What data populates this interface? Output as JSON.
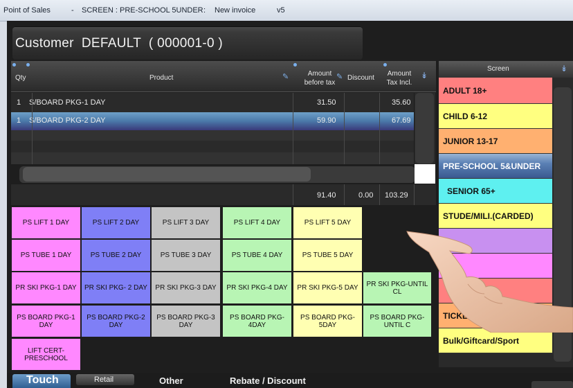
{
  "window": {
    "title_parts": [
      "Point of Sales",
      "-",
      "SCREEN : PRE-SCHOOL 5UNDER",
      ":",
      "New invoice",
      "v5"
    ]
  },
  "customer": {
    "label": "Customer  DEFAULT  ( 000001-0 )"
  },
  "grid": {
    "headers": {
      "qty": "Qty",
      "product": "Product",
      "amount_before_tax": [
        "Amount",
        "before tax"
      ],
      "discount": "Discount",
      "amount_tax_incl": [
        "Amount",
        "Tax Incl."
      ]
    },
    "rows": [
      {
        "qty": "1",
        "product": "S/BOARD PKG-1 DAY",
        "amount_before_tax": "31.50",
        "discount": "",
        "amount_tax_incl": "35.60",
        "selected": false
      },
      {
        "qty": "1",
        "product": "S/BOARD PKG-2 DAY",
        "amount_before_tax": "59.90",
        "discount": "",
        "amount_tax_incl": "67.69",
        "selected": true
      }
    ],
    "totals": {
      "amount_before_tax": "91.40",
      "discount": "0.00",
      "amount_tax_incl": "103.29"
    }
  },
  "product_buttons": [
    [
      {
        "label": "PS LIFT 1 DAY",
        "color": "#ff88ff"
      },
      {
        "label": "PS LIFT 2 DAY",
        "color": "#7f7ff6"
      },
      {
        "label": "PS LIFT 3 DAY",
        "color": "#c4c4c4"
      },
      {
        "label": "PS LIFT 4 DAY",
        "color": "#b8f5b4"
      },
      {
        "label": "PS LIFT 5 DAY",
        "color": "#ffffb2"
      }
    ],
    [
      {
        "label": "PS TUBE 1 DAY",
        "color": "#ff88ff"
      },
      {
        "label": "PS TUBE 2 DAY",
        "color": "#7f7ff6"
      },
      {
        "label": "PS TUBE 3 DAY",
        "color": "#c4c4c4"
      },
      {
        "label": "PS TUBE 4 DAY",
        "color": "#b8f5b4"
      },
      {
        "label": "PS TUBE 5 DAY",
        "color": "#ffffb2"
      }
    ],
    [
      {
        "label": "PR SKI PKG-1 DAY",
        "color": "#ff88ff"
      },
      {
        "label": "PR SKI PKG- 2 DAY",
        "color": "#7f7ff6"
      },
      {
        "label": "PR SKI PKG-3 DAY",
        "color": "#c4c4c4"
      },
      {
        "label": "PR SKI PKG-4 DAY",
        "color": "#b8f5b4"
      },
      {
        "label": "PR SKI PKG-5 DAY",
        "color": "#ffffb2"
      },
      {
        "label": "PR SKI PKG-UNTIL CL",
        "color": "#b8f5b4"
      }
    ],
    [
      {
        "label": "PS BOARD PKG-1 DAY",
        "color": "#ff88ff"
      },
      {
        "label": "PS BOARD PKG-2 DAY",
        "color": "#7f7ff6"
      },
      {
        "label": "PS BOARD PKG-3 DAY",
        "color": "#c4c4c4"
      },
      {
        "label": "PS BOARD PKG-4DAY",
        "color": "#b8f5b4"
      },
      {
        "label": "PS BOARD PKG-5DAY",
        "color": "#ffffb2"
      },
      {
        "label": "PS BOARD PKG-UNTIL C",
        "color": "#b8f5b4"
      }
    ],
    [
      {
        "label": "LIFT CERT-PRESCHOOL",
        "color": "#ff88ff"
      }
    ]
  ],
  "screen_panel": {
    "header": "Screen",
    "items": [
      {
        "label": "ADULT 18+",
        "color": "#ff8080",
        "selected": false
      },
      {
        "label": "CHILD 6-12",
        "color": "#ffff80",
        "selected": false
      },
      {
        "label": "JUNIOR  13-17",
        "color": "#ffb070",
        "selected": false
      },
      {
        "label": "PRE-SCHOOL 5&UNDER",
        "color": "#4a6fa8",
        "selected": true
      },
      {
        "label": "SENIOR 65+",
        "color": "#5ef0f0",
        "selected": false
      },
      {
        "label": "STUDE/MILI.(CARDED)",
        "color": "#ffff80",
        "selected": false
      },
      {
        "label": "",
        "color": "#c890f0",
        "selected": false
      },
      {
        "label": "",
        "color": "#ff88ff",
        "selected": false
      },
      {
        "label": "",
        "color": "#ff8080",
        "selected": false
      },
      {
        "label": "TICKET SPECIALS",
        "color": "#ffb070",
        "selected": false
      },
      {
        "label": "Bulk/Giftcard/Sport",
        "color": "#ffff80",
        "selected": false
      }
    ]
  },
  "bottom_tabs": [
    {
      "label": "Touch"
    },
    {
      "label": "Retail"
    },
    {
      "label": "Other"
    },
    {
      "label": "Rebate / Discount"
    }
  ]
}
